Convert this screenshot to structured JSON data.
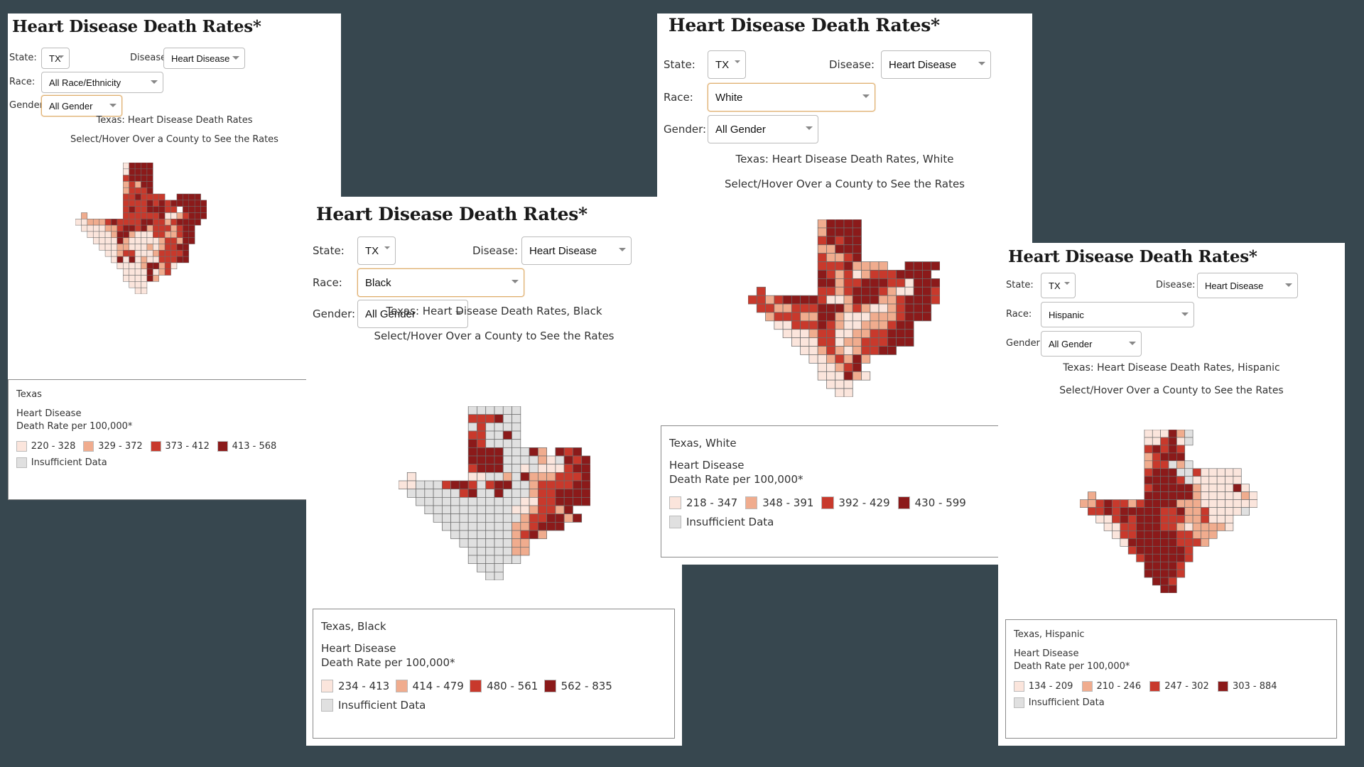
{
  "colors": {
    "background": "#37474f",
    "bins": [
      "#fbe5dc",
      "#f0ac8e",
      "#c8392c",
      "#8b1a1a"
    ],
    "insufficient": "#e0e0e0",
    "focus_border": "#e0b070"
  },
  "panels": [
    {
      "title": "Heart Disease Death Rates*",
      "state_label": "State:",
      "state_value": "TX",
      "disease_label": "Disease:",
      "disease_value": "Heart Disease",
      "race_label": "Race:",
      "race_value": "All Race/Ethnicity",
      "gender_label": "Gender:",
      "gender_value": "All Gender",
      "focused": "gender",
      "caption": "Texas: Heart Disease Death Rates",
      "hint": "Select/Hover Over a County to See the Rates",
      "legend": {
        "place": "Texas",
        "metric_line1": "Heart Disease",
        "metric_line2": "Death Rate per 100,000*",
        "bins": [
          "220 - 328",
          "329 - 372",
          "373 - 412",
          "413 - 568"
        ],
        "insufficient": "Insufficient Data"
      }
    },
    {
      "title": "Heart Disease Death Rates*",
      "state_label": "State:",
      "state_value": "TX",
      "disease_label": "Disease:",
      "disease_value": "Heart Disease",
      "race_label": "Race:",
      "race_value": "Black",
      "gender_label": "Gender:",
      "gender_value": "All Gender",
      "focused": "race",
      "caption": "Texas: Heart Disease Death Rates, Black",
      "hint": "Select/Hover Over a County to See the Rates",
      "legend": {
        "place": "Texas, Black",
        "metric_line1": "Heart Disease",
        "metric_line2": "Death Rate per 100,000*",
        "bins": [
          "234 - 413",
          "414 - 479",
          "480 - 561",
          "562 - 835"
        ],
        "insufficient": "Insufficient Data"
      }
    },
    {
      "title": "Heart Disease Death Rates*",
      "state_label": "State:",
      "state_value": "TX",
      "disease_label": "Disease:",
      "disease_value": "Heart Disease",
      "race_label": "Race:",
      "race_value": "White",
      "gender_label": "Gender:",
      "gender_value": "All Gender",
      "focused": "race",
      "caption": "Texas: Heart Disease Death Rates, White",
      "hint": "Select/Hover Over a County to See the Rates",
      "legend": {
        "place": "Texas, White",
        "metric_line1": "Heart Disease",
        "metric_line2": "Death Rate per 100,000*",
        "bins": [
          "218 - 347",
          "348 - 391",
          "392 - 429",
          "430 - 599"
        ],
        "insufficient": "Insufficient Data"
      }
    },
    {
      "title": "Heart Disease Death Rates*",
      "state_label": "State:",
      "state_value": "TX",
      "disease_label": "Disease:",
      "disease_value": "Heart Disease",
      "race_label": "Race:",
      "race_value": "Hispanic",
      "gender_label": "Gender:",
      "gender_value": "All Gender",
      "focused": "none",
      "caption": "Texas: Heart Disease Death Rates, Hispanic",
      "hint": "Select/Hover Over a County to See the Rates",
      "legend": {
        "place": "Texas, Hispanic",
        "metric_line1": "Heart Disease",
        "metric_line2": "Death Rate per 100,000*",
        "bins": [
          "134 - 209",
          "210 - 246",
          "247 - 302",
          "303 - 884"
        ],
        "insufficient": "Insufficient Data"
      }
    }
  ],
  "chart_data": [
    {
      "type": "heatmap",
      "title": "Texas: Heart Disease Death Rates",
      "subtitle": "Select/Hover Over a County to See the Rates",
      "legend_title": "Heart Disease Death Rate per 100,000*",
      "classes": [
        "220 - 328",
        "329 - 372",
        "373 - 412",
        "413 - 568",
        "Insufficient Data"
      ],
      "grid_codes": "0-3 = rate class, g = insufficient data, . = outside Texas (approximate county grid)",
      "grid": [
        "........03333.........",
        "........03333.........",
        "........23333.........",
        "........12133.........",
        "........12223.........",
        "........2232222..3333.",
        "........22223232333333",
        "........232233322.3333",
        ".1......22222230012333",
        "001112322223322123333.",
        ".0000112332312221233..",
        "..000013310002211233..",
        "...00003100000122133..",
        "....000110001012233...",
        ".....00122000122223...",
        "......0303010022233...",
        ".......0000133120.....",
        "........00003012......",
        "........000031........",
        ".........000..........",
        "..........00.........."
      ]
    },
    {
      "type": "heatmap",
      "title": "Texas: Heart Disease Death Rates, Black",
      "subtitle": "Select/Hover Over a County to See the Rates",
      "legend_title": "Heart Disease Death Rate per 100,000*",
      "classes": [
        "234 - 413",
        "414 - 479",
        "480 - 561",
        "562 - 835",
        "Insufficient Data"
      ],
      "grid_codes": "0-3 = rate class, g = insufficient data, . = outside Texas (approximate county grid)",
      "grid": [
        "........gggggg........",
        "........2223gg........",
        "........g2gggg........",
        "........22gg3g........",
        "........32gggg........",
        "........3333ggg31.323.",
        "........3333gggg10g323",
        "........2333gg0g000233",
        ".0......00gg1g31112223",
        "00ggg2332g233gg1222233",
        ".gggggg23gg3ggg1223333",
        "..gggggggggggg00223333",
        "...gggggggggg0012213..",
        "....gggggggggg1223313.",
        ".....gggggggg112333...",
        "......ggggggg1231.....",
        ".......gggggg11.......",
        "........ggggg11.......",
        "........gggggg........",
        ".........ggg..........",
        "..........gg.........."
      ]
    },
    {
      "type": "heatmap",
      "title": "Texas: Heart Disease Death Rates, White",
      "subtitle": "Select/Hover Over a County to See the Rates",
      "legend_title": "Heart Disease Death Rate per 100,000*",
      "classes": [
        "218 - 347",
        "348 - 391",
        "392 - 429",
        "430 - 599",
        "Insufficient Data"
      ],
      "grid_codes": "0-3 = rate class, g = insufficient data, . = outside Texas (approximate county grid)",
      "grid": [
        "........13333.........",
        "........13333.........",
        "........23233.........",
        "........11333.........",
        "........21123.........",
        "........22231111..3333",
        "........3212012223333.",
        "........33122333220333",
        ".2......22123332100332",
        "2212333320013331123332",
        ".22112223331210012333.",
        "..1222113310001112333.",
        "...0022232100111233...",
        "....000122001122333...",
        ".....00022011222333...",
        "......00121012233.....",
        ".......0012131........",
        "........00123.........",
        "........000310........",
        ".........000..........",
        "..........00.........."
      ]
    },
    {
      "type": "heatmap",
      "title": "Texas: Heart Disease Death Rates, Hispanic",
      "subtitle": "Select/Hover Over a County to See the Rates",
      "legend_title": "Heart Disease Death Rate per 100,000*",
      "classes": [
        "134 - 209",
        "210 - 246",
        "247 - 302",
        "303 - 884",
        "Insufficient Data"
      ],
      "grid_codes": "0-3 = rate class, g = insufficient data, . = outside Texas (approximate county grid)",
      "grid": [
        "........00031g........",
        "........00230g........",
        "........23232.........",
        "........12333.........",
        "........122g1g........",
        "........2333gg200000..",
        "........33332g000000..",
        "........2333331000030.",
        ".1......33333310000010",
        "1123221233331110000000",
        ".2232333332231120000g.",
        "..00232333222112000...",
        "...0022333221011110...",
        "....0223333322111.....",
        ".....03333332221......",
        "......23333332........",
        ".......2333332........",
        "........33332.........",
        "........33332.........",
        ".........332..........",
        "..........33.........."
      ]
    }
  ]
}
